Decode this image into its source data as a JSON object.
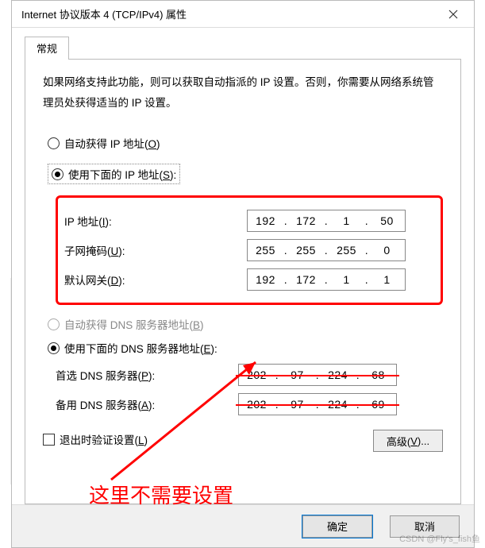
{
  "title": "Internet 协议版本 4 (TCP/IPv4) 属性",
  "tab_general": "常规",
  "description": "如果网络支持此功能，则可以获取自动指派的 IP 设置。否则，你需要从网络系统管理员处获得适当的 IP 设置。",
  "ip_section": {
    "auto_label_pre": "自动获得 IP 地址(",
    "auto_accel": "O",
    "manual_label_pre": "使用下面的 IP 地址(",
    "manual_accel": "S",
    "close_paren": "):",
    "ip_label_pre": "IP 地址(",
    "ip_accel": "I",
    "ip": {
      "a": "192",
      "b": "172",
      "c": "1",
      "d": "50"
    },
    "mask_label_pre": "子网掩码(",
    "mask_accel": "U",
    "mask": {
      "a": "255",
      "b": "255",
      "c": "255",
      "d": "0"
    },
    "gw_label_pre": "默认网关(",
    "gw_accel": "D",
    "gw": {
      "a": "192",
      "b": "172",
      "c": "1",
      "d": "1"
    }
  },
  "dns_section": {
    "auto_label_pre": "自动获得 DNS 服务器地址(",
    "auto_accel": "B",
    "close_paren": ")",
    "manual_label_pre": "使用下面的 DNS 服务器地址(",
    "manual_accel": "E",
    "manual_close": "):",
    "pri_label_pre": "首选 DNS 服务器(",
    "pri_accel": "P",
    "pri": {
      "a": "202",
      "b": "97",
      "c": "224",
      "d": "68"
    },
    "alt_label_pre": "备用 DNS 服务器(",
    "alt_accel": "A",
    "alt": {
      "a": "202",
      "b": "97",
      "c": "224",
      "d": "69"
    }
  },
  "validate_label_pre": "退出时验证设置(",
  "validate_accel": "L",
  "advanced_label_pre": "高级(",
  "advanced_accel": "V",
  "advanced_close": ")...",
  "ok": "确定",
  "cancel": "取消",
  "annotation": "这里不需要设置",
  "watermark": "CSDN @Fly's_fish鱼"
}
